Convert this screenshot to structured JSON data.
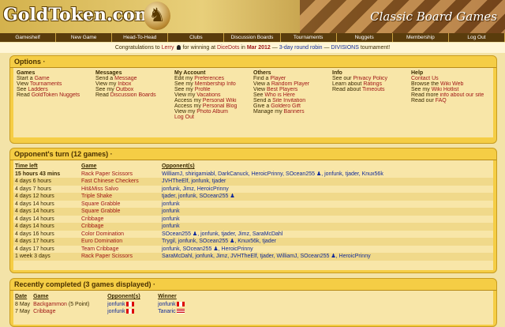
{
  "header": {
    "logo": "GoldToken.com",
    "tagline": "Classic Board Games"
  },
  "nav": [
    "Gameshelf",
    "New Game",
    "Head-To-Head",
    "Clubs",
    "Discussion Boards",
    "Tournaments",
    "Nuggets",
    "Membership",
    "Log Out"
  ],
  "congrats": {
    "pre": "Congratulations to",
    "user": "Lerry",
    "mid": "for winning at",
    "site": "DiceDots",
    "in": "in",
    "month": "Mar 2012",
    "dash": "—",
    "event": "3-day round robin",
    "dash2": "—",
    "divisions": "DIVISIONS",
    "post": "tournament!"
  },
  "options": {
    "title": "Options ·",
    "columns": [
      {
        "head": "Games",
        "items": [
          [
            "Start a ",
            "Game"
          ],
          [
            "View ",
            "Tournaments"
          ],
          [
            "See ",
            "Ladders"
          ],
          [
            "Read ",
            "GoldToken Nuggets"
          ]
        ]
      },
      {
        "head": "Messages",
        "items": [
          [
            "Send a ",
            "Message"
          ],
          [
            "View my ",
            "Inbox"
          ],
          [
            "See my ",
            "Outbox"
          ],
          [
            "Read ",
            "Discussion Boards"
          ]
        ]
      },
      {
        "head": "My Account",
        "items": [
          [
            "Edit my ",
            "Preferences"
          ],
          [
            "See my ",
            "Membership Info"
          ],
          [
            "See my ",
            "Profile"
          ],
          [
            "View my ",
            "Vacations"
          ],
          [
            "Access my ",
            "Personal Wiki"
          ],
          [
            "Access my ",
            "Personal Blog"
          ],
          [
            "View my ",
            "Photo Album"
          ],
          [
            "",
            "Log Out"
          ]
        ]
      },
      {
        "head": "Others",
        "items": [
          [
            "Find a ",
            "Player"
          ],
          [
            "View a ",
            "Random Player"
          ],
          [
            "View ",
            "Best Players"
          ],
          [
            "See ",
            "Who is Here"
          ],
          [
            "Send a ",
            "Site Invitation"
          ],
          [
            "Give a ",
            "Goldero Gift"
          ],
          [
            "Manage my ",
            "Banners"
          ]
        ]
      },
      {
        "head": "Info",
        "items": [
          [
            "See our ",
            "Privacy Policy"
          ],
          [
            "Learn about ",
            "Ratings"
          ],
          [
            "Read about ",
            "Timeouts"
          ]
        ]
      },
      {
        "head": "Help",
        "items": [
          [
            "",
            "Contact Us"
          ],
          [
            "Browse the ",
            "Wiki Web"
          ],
          [
            "See my ",
            "Wiki Hotlist"
          ],
          [
            "Read more ",
            "info about our site"
          ],
          [
            "Read our ",
            "FAQ"
          ]
        ]
      }
    ]
  },
  "turn": {
    "title": "Opponent's turn (12 games) ·",
    "headers": [
      "Time left",
      "Game",
      "Opponent(s)"
    ],
    "rows": [
      {
        "time": "15 hours 43 mins",
        "game": "Rack Paper Scissors",
        "opp": "WilliamJ, shirigamiabl, DarkCanuck, HeroicPrinny, SOcean255 ♟, jonfunk, tjader, Knux56k"
      },
      {
        "time": "4 days 6 hours",
        "game": "Fast Chinese Checkers",
        "opp": "JVHTheElf, jonfunk, tjader"
      },
      {
        "time": "4 days 7 hours",
        "game": "Hit&Miss Salvo",
        "opp": "jonfunk, Jimz, HeroicPrinny"
      },
      {
        "time": "4 days 12 hours",
        "game": "Triple Shake",
        "opp": "tjader, jonfunk, SOcean255 ♟"
      },
      {
        "time": "4 days 14 hours",
        "game": "Square Grabble",
        "opp": "jonfunk"
      },
      {
        "time": "4 days 14 hours",
        "game": "Square Grabble",
        "opp": "jonfunk"
      },
      {
        "time": "4 days 14 hours",
        "game": "Cribbage",
        "opp": "jonfunk"
      },
      {
        "time": "4 days 14 hours",
        "game": "Cribbage",
        "opp": "jonfunk"
      },
      {
        "time": "4 days 16 hours",
        "game": "Color Domination",
        "opp": "SOcean255 ♟, jonfunk, tjader, Jimz, SaraMcDahl"
      },
      {
        "time": "4 days 17 hours",
        "game": "Euro Domination",
        "opp": "Trygil, jonfunk, SOcean255 ♟, Knux56k, tjader"
      },
      {
        "time": "4 days 17 hours",
        "game": "Team Cribbage",
        "opp": "jonfunk, SOcean255 ♟, HeroicPrinny"
      },
      {
        "time": "1 week 3 days",
        "game": "Rack Paper Scissors",
        "opp": "SaraMcDahl, jonfunk, Jimz, JVHTheElf, tjader, WilliamJ, SOcean255 ♟, HeroicPrinny"
      }
    ]
  },
  "recent": {
    "title": "Recently completed (3 games displayed) ·",
    "headers": [
      "Date",
      "Game",
      "Opponent(s)",
      "Winner"
    ],
    "rows": [
      {
        "date": "8 May",
        "game": "Backgammon",
        "note": "(5 Point)",
        "opp": "jonfunk",
        "winner": "jonfunk"
      },
      {
        "date": "7 May",
        "game": "Cribbage",
        "note": "",
        "opp": "jonfunk",
        "winner": "Tanaric"
      }
    ]
  }
}
